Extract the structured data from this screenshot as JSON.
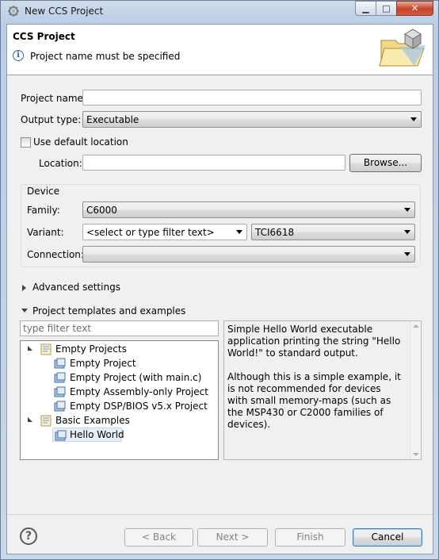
{
  "window": {
    "title": "New CCS Project",
    "minimize_glyph": "▁",
    "maximize_glyph": "□",
    "close_glyph": "✕"
  },
  "header": {
    "title": "CCS Project",
    "message": "Project name must be specified",
    "info_glyph": "i"
  },
  "form": {
    "project_name_label": "Project name:",
    "project_name_value": "",
    "output_type_label": "Output type:",
    "output_type_value": "Executable",
    "use_default_location_label": "Use default location",
    "use_default_location_checked": false,
    "location_label": "Location:",
    "location_value": "",
    "browse_label": "Browse..."
  },
  "device": {
    "group_title": "Device",
    "family_label": "Family:",
    "family_value": "C6000",
    "variant_label": "Variant:",
    "variant_filter_value": "<select or type filter text>",
    "variant_value": "TCI6618",
    "connection_label": "Connection:",
    "connection_value": ""
  },
  "advanced": {
    "label": "Advanced settings",
    "expanded": false
  },
  "templates": {
    "label": "Project templates and examples",
    "expanded": true,
    "filter_placeholder": "type filter text",
    "tree": [
      {
        "label": "Empty Projects",
        "type": "folder",
        "expanded": true
      },
      {
        "label": "Empty Project",
        "type": "item"
      },
      {
        "label": "Empty Project (with main.c)",
        "type": "item"
      },
      {
        "label": "Empty Assembly-only Project",
        "type": "item"
      },
      {
        "label": "Empty DSP/BIOS v5.x Project",
        "type": "item"
      },
      {
        "label": "Basic Examples",
        "type": "folder",
        "expanded": true
      },
      {
        "label": "Hello World",
        "type": "item",
        "selected": true
      }
    ],
    "description_p1": "Simple Hello World executable application printing the string \"Hello World!\" to standard output.",
    "description_p2": "Although this is a simple example, it is not recommended for devices with small memory-maps (such as the MSP430 or C2000 families of devices)."
  },
  "footer": {
    "help_glyph": "?",
    "back_label": "< Back",
    "next_label": "Next >",
    "finish_label": "Finish",
    "cancel_label": "Cancel"
  }
}
